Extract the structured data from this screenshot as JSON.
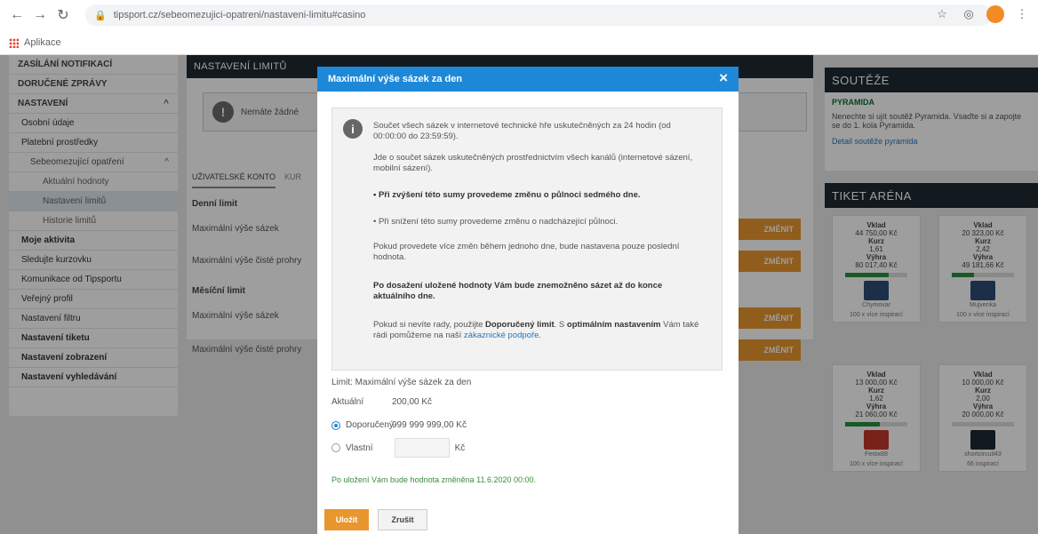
{
  "browser": {
    "url": "tipsport.cz/sebeomezujici-opatreni/nastaveni-limitu#casino",
    "bookmarks_label": "Aplikace",
    "avatar_letter": ""
  },
  "left_menu": {
    "items": [
      {
        "label": "Zasílání notifikací",
        "kind": "head"
      },
      {
        "label": "Doručené zprávy",
        "kind": "head"
      },
      {
        "label": "Nastavení",
        "kind": "head",
        "chev": "^"
      },
      {
        "label": "Osobní údaje",
        "kind": "l1"
      },
      {
        "label": "Platební prostředky",
        "kind": "l1"
      },
      {
        "label": "Sebeomezující opatření",
        "kind": "l2",
        "chev": "^"
      },
      {
        "label": "Aktuální hodnoty",
        "kind": "l3"
      },
      {
        "label": "Nastavení limitů",
        "kind": "l3",
        "active": true
      },
      {
        "label": "Historie limitů",
        "kind": "l3"
      },
      {
        "label": "Moje aktivita",
        "kind": "l1 bold"
      },
      {
        "label": "Sledujte kurzovku",
        "kind": "l1"
      },
      {
        "label": "Komunikace od Tipsportu",
        "kind": "l1"
      },
      {
        "label": "Veřejný profil",
        "kind": "l1"
      },
      {
        "label": "Nastavení filtru",
        "kind": "l1"
      },
      {
        "label": "Nastavení tiketu",
        "kind": "l1 bold"
      },
      {
        "label": "Nastavení zobrazení",
        "kind": "l1 bold"
      },
      {
        "label": "Nastavení vyhledávání",
        "kind": "l1 bold"
      }
    ]
  },
  "content": {
    "title": "Nastavení limitů",
    "notice": "Nemáte žádné",
    "tabs": [
      "Uživatelské konto",
      "Kur"
    ],
    "rows": [
      {
        "label": "Denní limit",
        "h": true
      },
      {
        "label": "Maximální výše sázek",
        "h": false
      },
      {
        "label": "Maximální výše čisté prohry",
        "h": false
      },
      {
        "label": "Měsíční limit",
        "h": true
      },
      {
        "label": "Maximální výše sázek",
        "h": false
      },
      {
        "label": "Maximální výše čisté prohry",
        "h": false
      }
    ],
    "change_label": "Změnit"
  },
  "right": {
    "souteze_title": "Soutěže",
    "pyramida_tag": "Pyramida",
    "pyramida_text": "Nenechte si ujít soutěž Pyramida. Vsaďte si a zapojte se do 1. kola Pyramida.",
    "pyramida_link": "Detail soutěže pyramida",
    "tiket_title": "Tiket Aréna",
    "tickets": [
      {
        "vklad_lbl": "Vklad",
        "vklad": "44 750,00 Kč",
        "kurz_lbl": "Kurz",
        "kurz": "1,61",
        "vyhra_lbl": "Výhra",
        "vyhra": "80 017,40 Kč",
        "progress": 0.7,
        "foot": "Chymovar",
        "foot2": "100 x více inspirací",
        "logo": "#2d4d77"
      },
      {
        "vklad_lbl": "Vklad",
        "vklad": "20 323,00 Kč",
        "kurz_lbl": "Kurz",
        "kurz": "2,42",
        "vyhra_lbl": "Výhra",
        "vyhra": "49 181,66 Kč",
        "progress": 0.35,
        "foot": "Mujvenka",
        "foot2": "100 x více inspirací",
        "logo": "#2d4d77"
      },
      {
        "vklad_lbl": "Vklad",
        "vklad": "13 000,00 Kč",
        "kurz_lbl": "Kurz",
        "kurz": "1,62",
        "vyhra_lbl": "Výhra",
        "vyhra": "21 060,00 Kč",
        "progress": 0.55,
        "foot": "Ferox88",
        "foot2": "100 x více inspirací",
        "logo": "#c0392b"
      },
      {
        "vklad_lbl": "Vklad",
        "vklad": "10 000,00 Kč",
        "kurz_lbl": "Kurz",
        "kurz": "2,00",
        "vyhra_lbl": "Výhra",
        "vyhra": "20 000,00 Kč",
        "progress": 0.0,
        "foot": "shortcircuit43",
        "foot2": "66 inspirací",
        "logo": "#1d2b35"
      }
    ]
  },
  "modal": {
    "title": "Maximální výše sázek za den",
    "close": "×",
    "info": {
      "p1": "Součet všech sázek v internetové technické hře uskutečněných za 24 hodin (od 00:00:00 do 23:59:59).",
      "p2": "Jde o součet sázek uskutečněných prostřednictvím všech kanálů (internetové sázení, mobilní sázení).",
      "p3": "• Při zvýšení této sumy provedeme změnu o půlnoci sedmého dne.",
      "p4": "• Při snížení této sumy provedeme změnu o nadcházející půlnoci.",
      "p5": "Pokud provedete více změn během jednoho dne, bude nastavena pouze poslední hodnota.",
      "p6": "Po dosažení uložené hodnoty Vám bude znemožněno sázet až do konce aktuálního dne.",
      "p7a": "Pokud si nevíte rady, použijte ",
      "p7b": "Doporučený limit",
      "p7c": ". S ",
      "p7d": "optimálním nastavením",
      "p7e": " Vám také rádi pomůžeme na naší ",
      "p7f": "zákaznické podpoře",
      "p7g": "."
    },
    "limit_title": "Limit: Maximální výše sázek za den",
    "current_label": "Aktuální",
    "current_value": "200,00 Kč",
    "recommended_label": "Doporučený",
    "recommended_value": "999 999 999,00 Kč",
    "custom_label": "Vlastní",
    "custom_unit": "Kč",
    "note": "Po uložení Vám bude hodnota změněna 11.6.2020 00:00.",
    "save": "Uložit",
    "cancel": "Zrušit"
  },
  "colors": {
    "brand_blue": "#1e88d8",
    "accent_orange": "#e8962e",
    "dark_header": "#1d2b35"
  }
}
